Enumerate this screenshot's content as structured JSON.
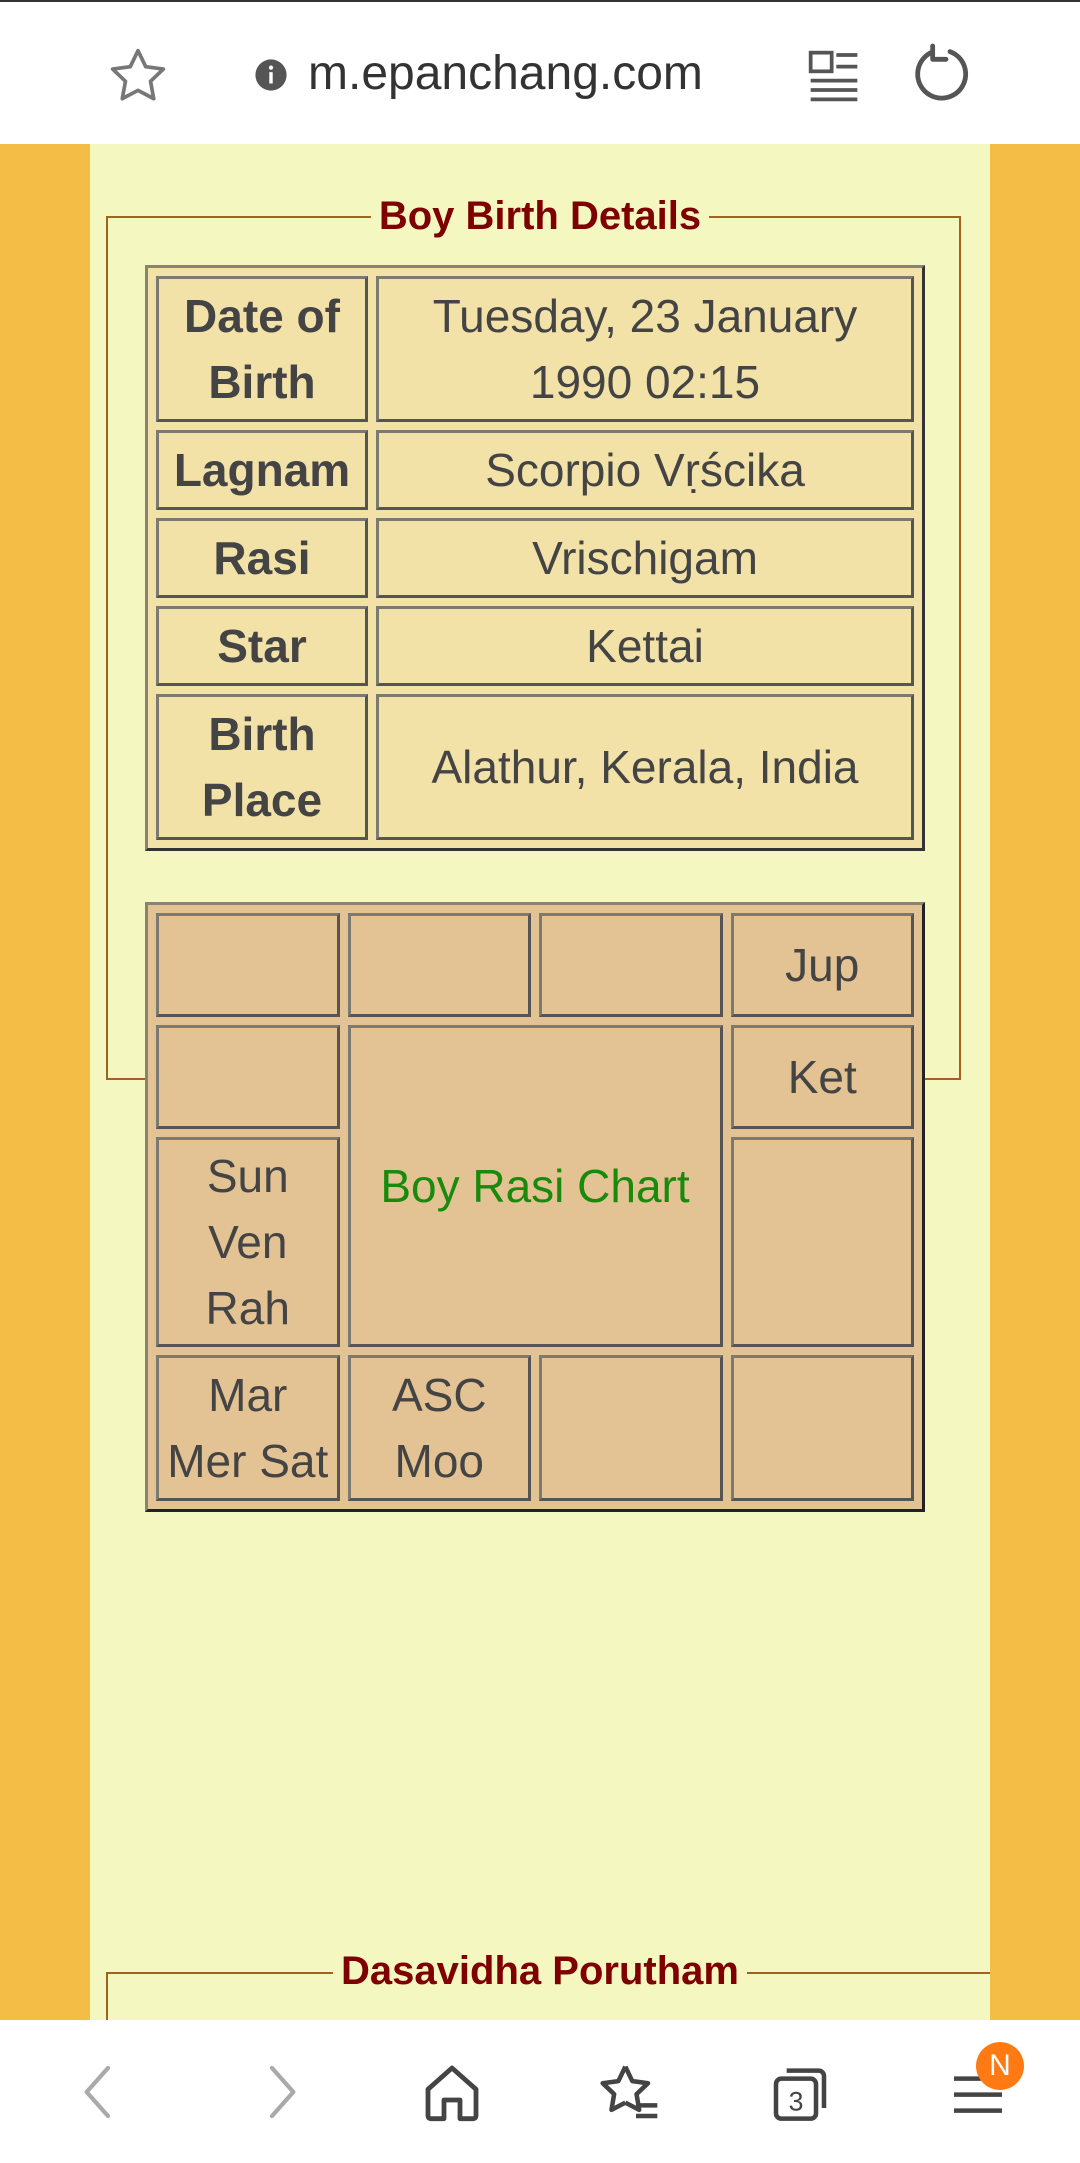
{
  "browser": {
    "url": "m.epanchang.com",
    "tab_count": "3",
    "notification_badge": "N"
  },
  "boy_birth_details": {
    "title": "Boy Birth Details",
    "rows": [
      {
        "label_line1": "Date of",
        "label_line2": "Birth",
        "value_line1": "Tuesday, 23 January",
        "value_line2": "1990 02:15"
      },
      {
        "label": "Lagnam",
        "value": "Scorpio Vṛścika"
      },
      {
        "label": "Rasi",
        "value": "Vrischigam"
      },
      {
        "label": "Star",
        "value": "Kettai"
      },
      {
        "label_line1": "Birth",
        "label_line2": "Place",
        "value": "Alathur, Kerala, India"
      }
    ]
  },
  "rasi_chart": {
    "title": "Boy Rasi Chart",
    "cells": {
      "r1c4": "Jup",
      "r2c4": "Ket",
      "r3c1_line1": "Sun",
      "r3c1_line2": "Ven",
      "r3c1_line3": "Rah",
      "r4c1_line1": "Mar",
      "r4c1_line2": "Mer Sat",
      "r4c2_line1": "ASC",
      "r4c2_line2": "Moo"
    }
  },
  "next_section": {
    "title": "Dasavidha Porutham"
  }
}
